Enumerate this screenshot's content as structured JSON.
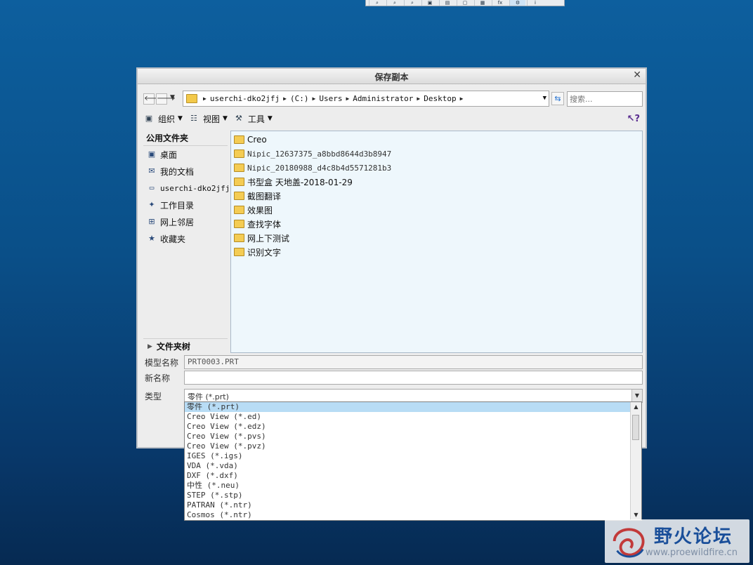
{
  "dialog": {
    "title": "保存副本",
    "close_glyph": "✕"
  },
  "nav": {
    "back_glyph": "🡐",
    "forward_glyph": "🡒",
    "history_glyph": "▼",
    "path": [
      "userchi-dko2jfj",
      "(C:)",
      "Users",
      "Administrator",
      "Desktop"
    ],
    "search_placeholder": "搜索..."
  },
  "toolbar": {
    "organize": "组织",
    "view": "视图",
    "tools": "工具"
  },
  "sidebar": {
    "header": "公用文件夹",
    "items": [
      {
        "label": "桌面",
        "icon": "desktop-icon"
      },
      {
        "label": "我的文档",
        "icon": "documents-icon"
      },
      {
        "label": "userchi-dko2jfj",
        "icon": "computer-icon"
      },
      {
        "label": "工作目录",
        "icon": "working-dir-icon"
      },
      {
        "label": "网上邻居",
        "icon": "network-icon"
      },
      {
        "label": "收藏夹",
        "icon": "favorites-icon"
      }
    ],
    "folder_tree": "文件夹树"
  },
  "files": [
    "Creo",
    "Nipic_12637375_a8bbd8644d3b8947",
    "Nipic_20180988_d4c8b4d5571281b3",
    "书型盒 天地盖-2018-01-29",
    "截图翻译",
    "效果图",
    "查找字体",
    "网上下测试",
    "识别文字"
  ],
  "form": {
    "model_name_label": "模型名称",
    "model_name_value": "PRT0003.PRT",
    "new_name_label": "新名称",
    "new_name_value": "",
    "type_label": "类型",
    "type_value": "零件 (*.prt)"
  },
  "type_options": [
    "零件 (*.prt)",
    "Creo View (*.ed)",
    "Creo View (*.edz)",
    "Creo View (*.pvs)",
    "Creo View (*.pvz)",
    "IGES (*.igs)",
    "VDA (*.vda)",
    "DXF (*.dxf)",
    "中性 (*.neu)",
    "STEP (*.stp)",
    "PATRAN (*.ntr)",
    "Cosmos (*.ntr)"
  ],
  "selected_type_index": 0,
  "watermark": {
    "brand": "野火论坛",
    "url": "www.proewildfire.cn"
  }
}
